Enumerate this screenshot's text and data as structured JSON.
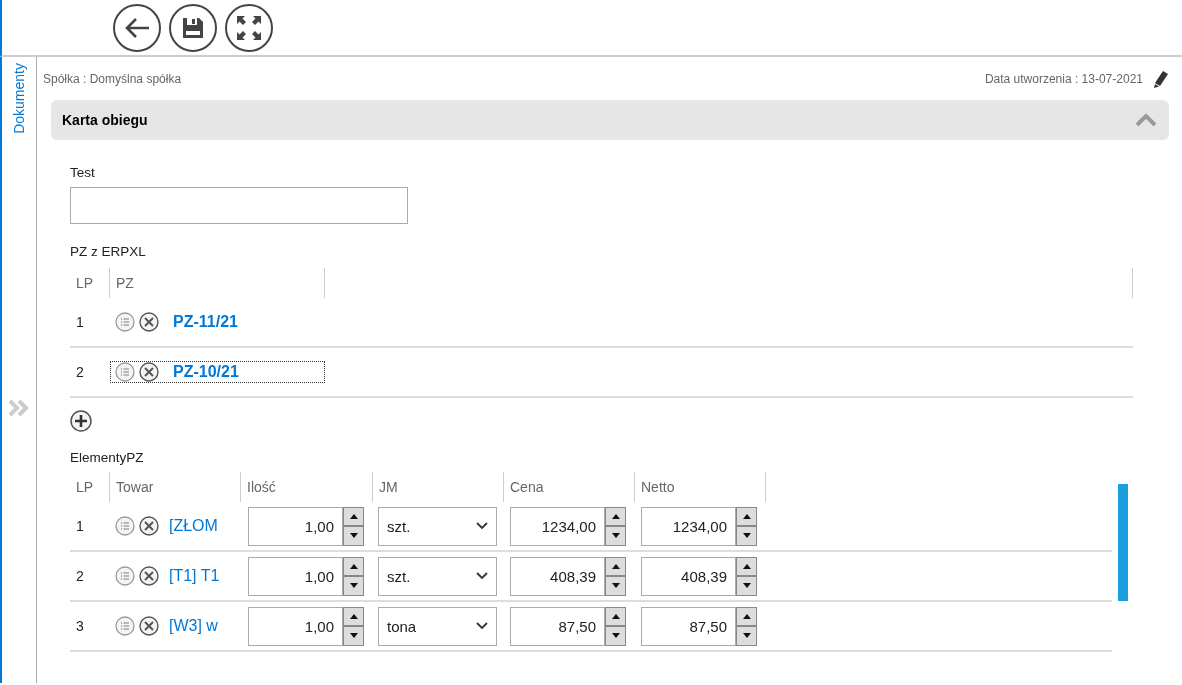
{
  "toolbar": {
    "buttons": [
      {
        "kind": "back"
      },
      {
        "kind": "save"
      },
      {
        "kind": "fullscreen"
      }
    ]
  },
  "sidebar": {
    "tab": "Dokumenty",
    "selected": true
  },
  "header": {
    "company": "Spółka : Domyślna spółka",
    "created": "Data utworzenia : 13-07-2021"
  },
  "section": {
    "title": "Karta obiegu",
    "expanded": true
  },
  "test_field": {
    "label": "Test"
  },
  "pz_table": {
    "label": "PZ z ERPXL",
    "columns": [
      "LP",
      "PZ"
    ],
    "rows": [
      {
        "lp": "1",
        "pz": "PZ-11/21",
        "focused": false
      },
      {
        "lp": "2",
        "pz": "PZ-10/21",
        "focused": true
      }
    ]
  },
  "elements_table": {
    "label": "ElementyPZ",
    "columns": [
      "LP",
      "Towar",
      "Ilość",
      "JM",
      "Cena",
      "Netto"
    ],
    "rows": [
      {
        "lp": "1",
        "towar": "[ZŁOM",
        "ilosc": "1,00",
        "jm": "szt.",
        "cena": "1234,00",
        "netto": "1234,00"
      },
      {
        "lp": "2",
        "towar": "[T1] T1",
        "ilosc": "1,00",
        "jm": "szt.",
        "cena": "408,39",
        "netto": "408,39"
      },
      {
        "lp": "3",
        "towar": "[W3] w",
        "ilosc": "1,00",
        "jm": "tona",
        "cena": "87,50",
        "netto": "87,50"
      }
    ]
  }
}
